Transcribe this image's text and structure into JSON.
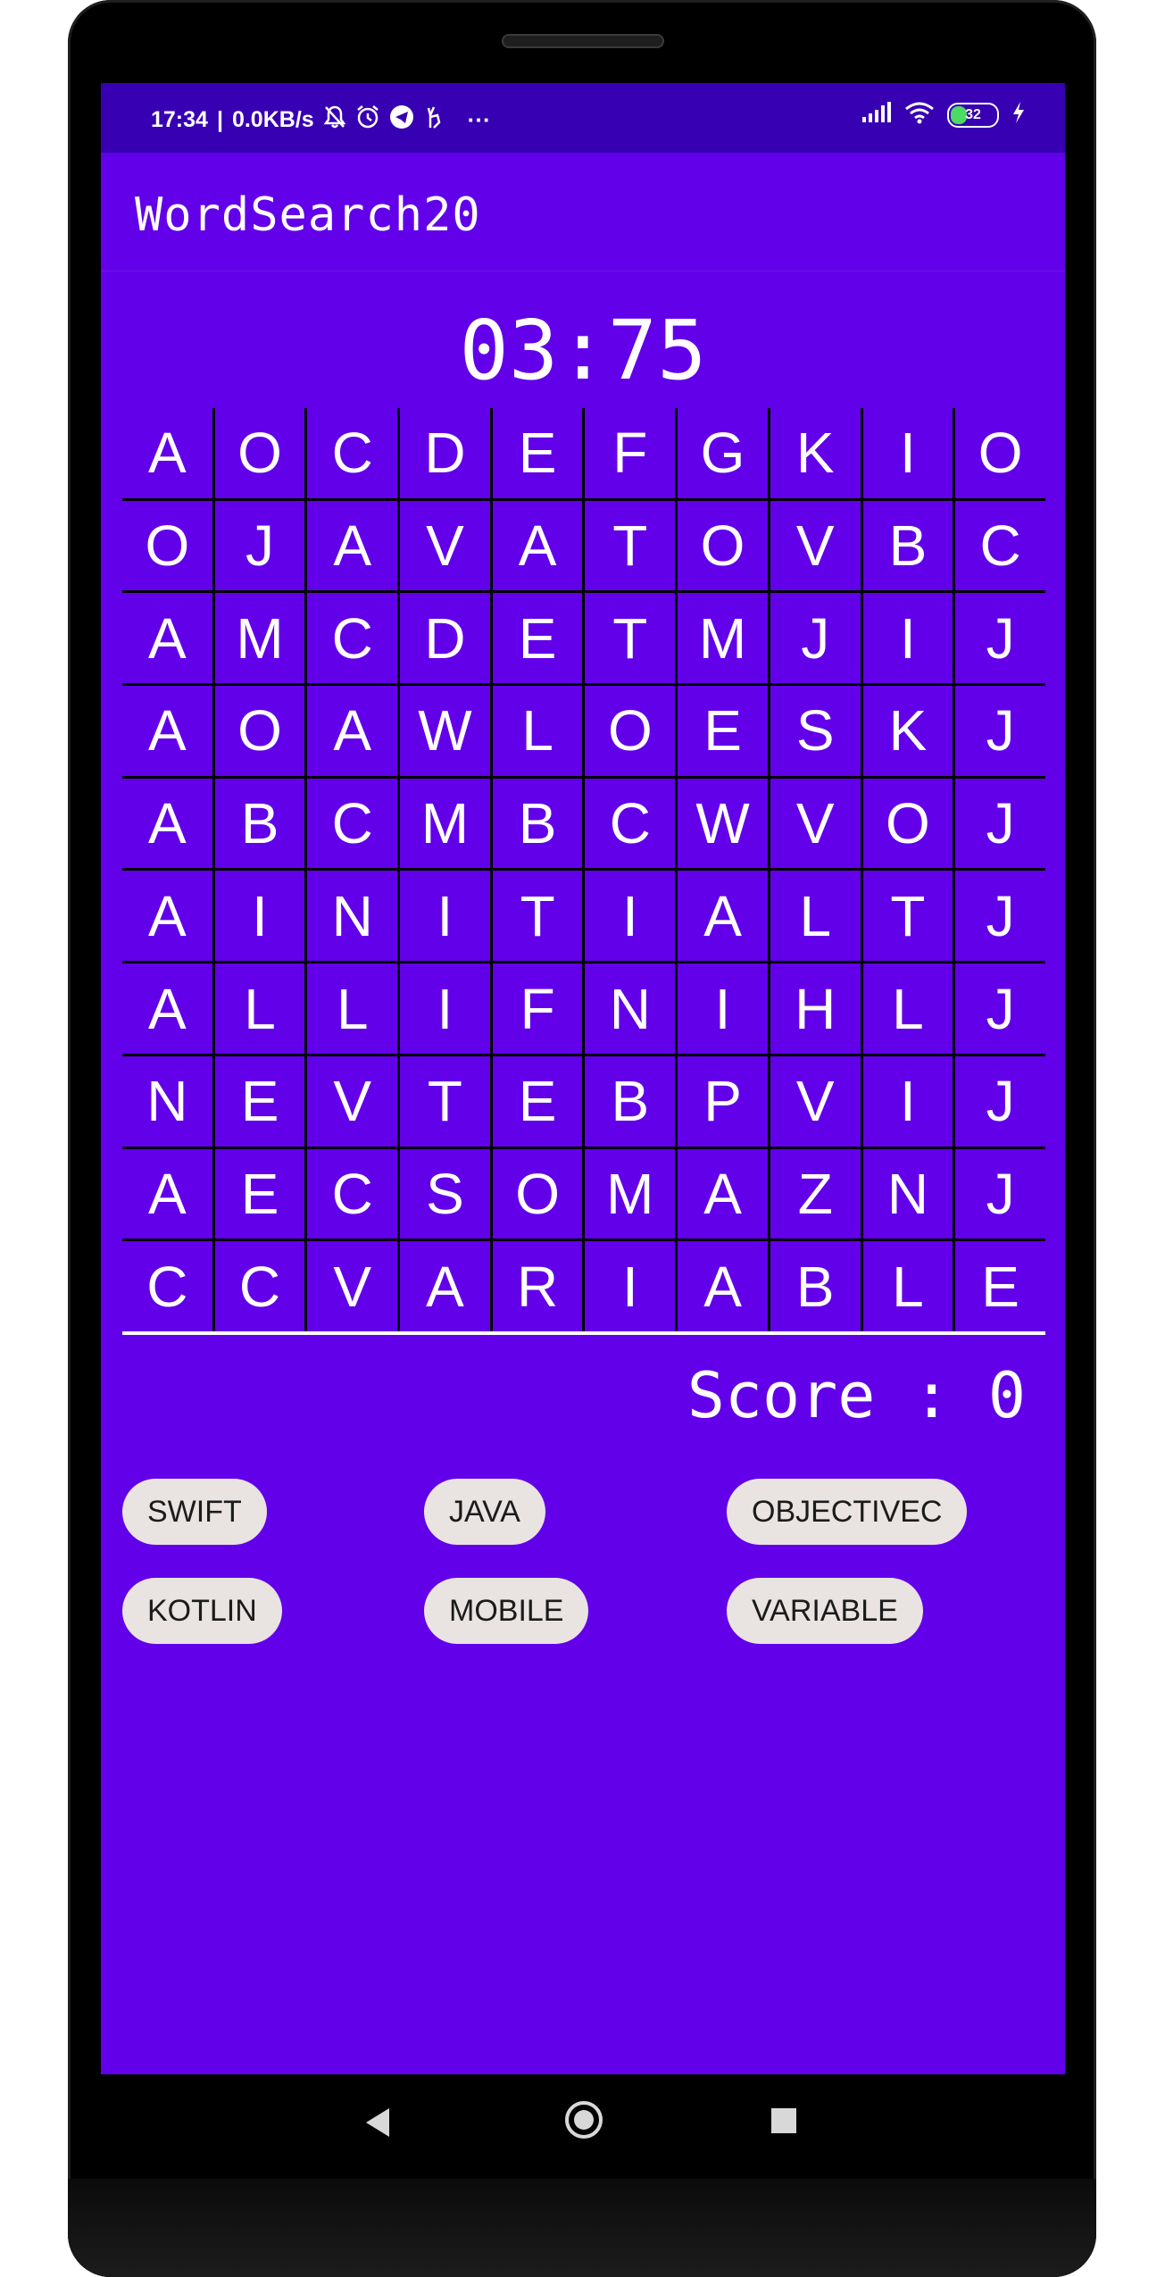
{
  "status_bar": {
    "time": "17:34",
    "network_speed": "0.0KB/s",
    "left_icons": [
      "bell-off-icon",
      "alarm-icon",
      "telegram-icon",
      "gesture-icon"
    ],
    "more": "···",
    "right_icons": [
      "signal-icon",
      "wifi-icon"
    ],
    "battery_level": "32",
    "charging_icon": "bolt-icon"
  },
  "app_bar": {
    "title": "WordSearch20"
  },
  "timer": "03:75",
  "grid": [
    [
      "A",
      "O",
      "C",
      "D",
      "E",
      "F",
      "G",
      "K",
      "I",
      "O"
    ],
    [
      "O",
      "J",
      "A",
      "V",
      "A",
      "T",
      "O",
      "V",
      "B",
      "C"
    ],
    [
      "A",
      "M",
      "C",
      "D",
      "E",
      "T",
      "M",
      "J",
      "I",
      "J"
    ],
    [
      "A",
      "O",
      "A",
      "W",
      "L",
      "O",
      "E",
      "S",
      "K",
      "J"
    ],
    [
      "A",
      "B",
      "C",
      "M",
      "B",
      "C",
      "W",
      "V",
      "O",
      "J"
    ],
    [
      "A",
      "I",
      "N",
      "I",
      "T",
      "I",
      "A",
      "L",
      "T",
      "J"
    ],
    [
      "A",
      "L",
      "L",
      "I",
      "F",
      "N",
      "I",
      "H",
      "L",
      "J"
    ],
    [
      "N",
      "E",
      "V",
      "T",
      "E",
      "B",
      "P",
      "V",
      "I",
      "J"
    ],
    [
      "A",
      "E",
      "C",
      "S",
      "O",
      "M",
      "A",
      "Z",
      "N",
      "J"
    ],
    [
      "C",
      "C",
      "V",
      "A",
      "R",
      "I",
      "A",
      "B",
      "L",
      "E"
    ]
  ],
  "score": {
    "label": "Score : 0"
  },
  "words": [
    "SWIFT",
    "JAVA",
    "OBJECTIVEC",
    "KOTLIN",
    "MOBILE",
    "VARIABLE"
  ],
  "colors": {
    "primary": "#6200ea",
    "primary_dark": "#3700b3",
    "chip_background": "#e9e3e2",
    "text_on_primary": "#ffffff"
  },
  "nav_bar": {
    "buttons": [
      "back-icon",
      "home-icon",
      "recents-icon"
    ]
  }
}
